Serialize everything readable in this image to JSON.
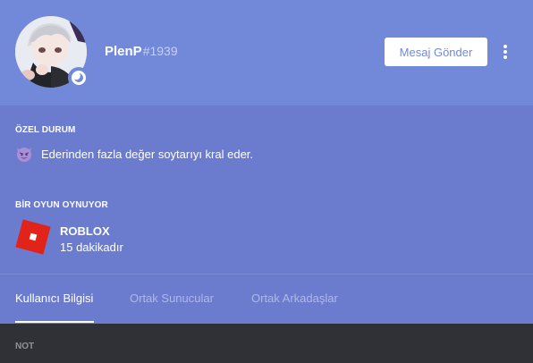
{
  "profile": {
    "username": "PlenP",
    "discriminator": "#1939",
    "avatar_icon": "anime-avatar-icon",
    "status_icon": "idle-moon-icon"
  },
  "header": {
    "message_button": "Mesaj Gönder",
    "more_icon": "more-vertical-icon"
  },
  "custom_status": {
    "title": "ÖZEL DURUM",
    "emoji": "smiling-imp-icon",
    "text": "Ederinden fazla değer soytarıyı kral eder."
  },
  "activity": {
    "title": "BİR OYUN OYNUYOR",
    "game_icon": "roblox-logo-icon",
    "game_name": "ROBLOX",
    "elapsed": "15 dakikadır"
  },
  "tabs": [
    {
      "label": "Kullanıcı Bilgisi",
      "active": true
    },
    {
      "label": "Ortak Sunucular",
      "active": false
    },
    {
      "label": "Ortak Arkadaşlar",
      "active": false
    }
  ],
  "note": {
    "title": "NOT"
  },
  "colors": {
    "header": "#7289da",
    "body": "#6b7ccf",
    "dark": "#2f3136",
    "roblox": "#e2231a"
  }
}
